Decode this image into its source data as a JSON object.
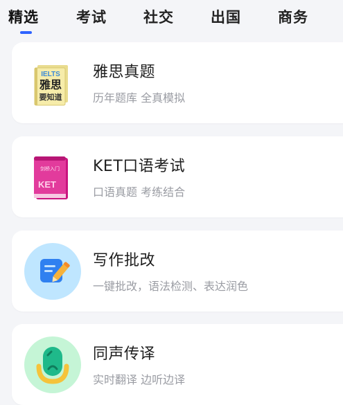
{
  "tabs": [
    {
      "label": "精选",
      "active": true
    },
    {
      "label": "考试",
      "active": false
    },
    {
      "label": "社交",
      "active": false
    },
    {
      "label": "出国",
      "active": false
    },
    {
      "label": "商务",
      "active": false
    }
  ],
  "colors": {
    "accent": "#2e63ff",
    "background": "#f4f5f8",
    "card": "#ffffff",
    "subtitle": "#9a9ca3"
  },
  "cards": [
    {
      "title": "雅思真题",
      "subtitle": "历年题库 全真模拟",
      "icon": "ielts-book-icon",
      "icon_text": {
        "line1": "IELTS",
        "line2": "雅思",
        "line3": "要知道"
      }
    },
    {
      "title": "KET口语考试",
      "subtitle": "口语真题 考练结合",
      "icon": "ket-book-icon",
      "icon_text": {
        "line1": "剑桥入门",
        "line2": "KET"
      }
    },
    {
      "title": "写作批改",
      "subtitle": "一键批改，语法检测、表达润色",
      "icon": "writing-pencil-icon"
    },
    {
      "title": "同声传译",
      "subtitle": "实时翻译 边听边译",
      "icon": "microphone-icon"
    }
  ]
}
